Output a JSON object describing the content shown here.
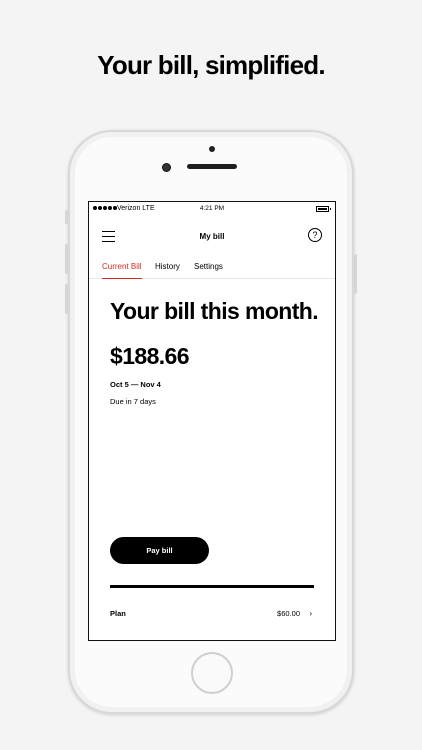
{
  "headline": "Your bill, simplified.",
  "status_bar": {
    "carrier": "Verizon  LTE",
    "time": "4:21 PM"
  },
  "nav": {
    "title": "My bill",
    "menu_icon": "hamburger-menu-icon",
    "help_icon": "question-mark-icon",
    "help_glyph": "?"
  },
  "tabs": [
    {
      "label": "Current Bill",
      "active": true
    },
    {
      "label": "History",
      "active": false
    },
    {
      "label": "Settings",
      "active": false
    }
  ],
  "bill": {
    "heading": "Your bill this month.",
    "amount": "$188.66",
    "period": "Oct 5 — Nov 4",
    "due": "Due in 7 days"
  },
  "pay_button": {
    "label": "Pay bill"
  },
  "plan": {
    "label": "Plan",
    "amount": "$60.00",
    "chevron": "›"
  },
  "colors": {
    "accent": "#d52b1e",
    "button": "#000000",
    "background": "#f4f4f4"
  }
}
